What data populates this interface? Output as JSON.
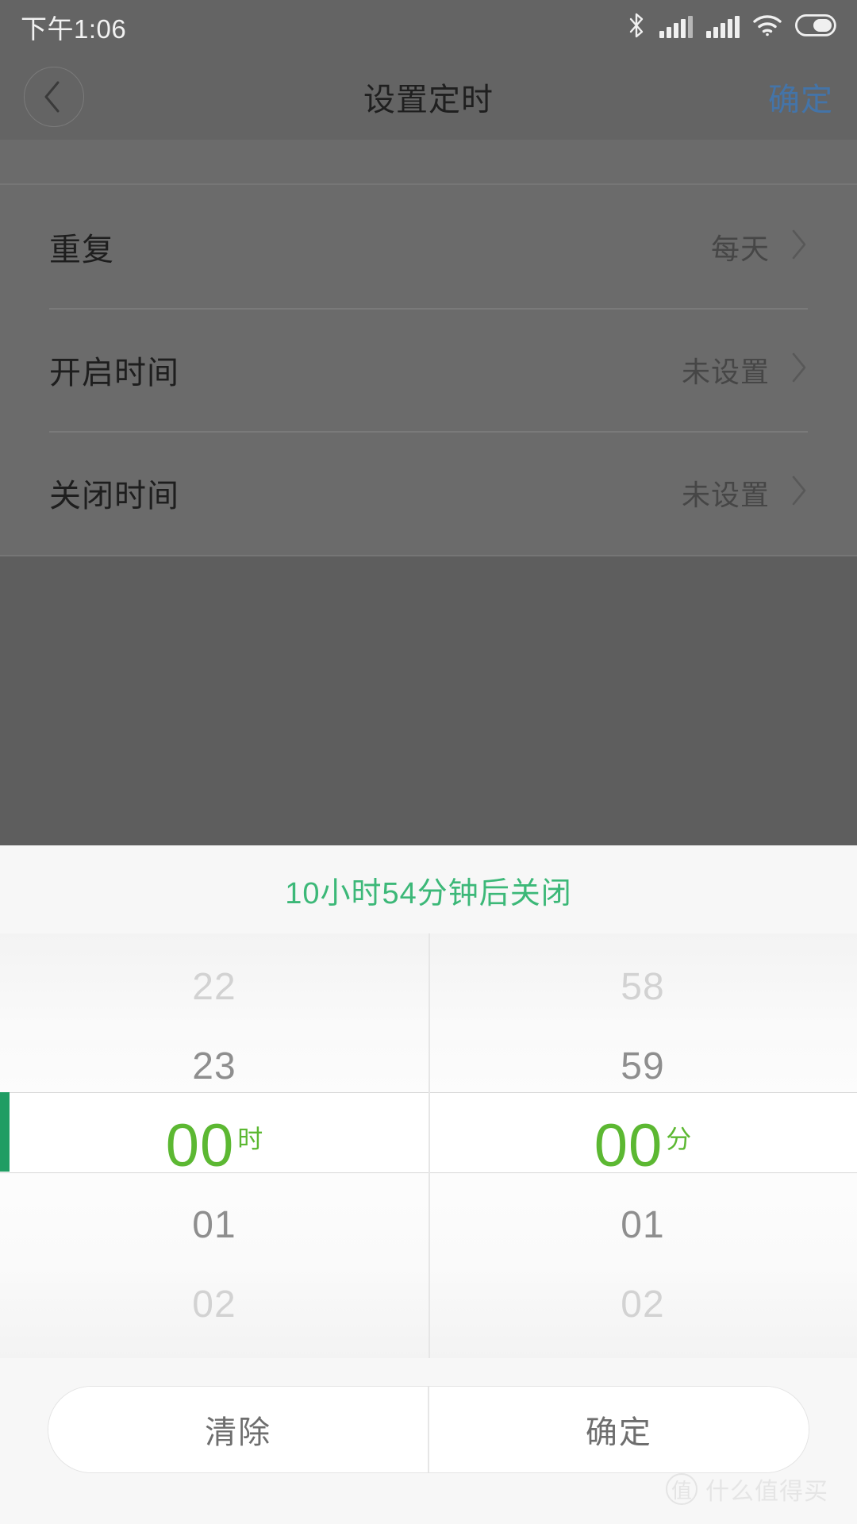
{
  "status_bar": {
    "time": "下午1:06",
    "icons": [
      "bluetooth-icon",
      "signal-icon-1",
      "signal-icon-2",
      "wifi-icon",
      "battery-icon"
    ]
  },
  "title_bar": {
    "back_icon": "chevron-left-icon",
    "title": "设置定时",
    "confirm_label": "确定"
  },
  "settings": {
    "rows": [
      {
        "label": "重复",
        "value": "每天",
        "chevron": "chevron-right-icon"
      },
      {
        "label": "开启时间",
        "value": "未设置",
        "chevron": "chevron-right-icon"
      },
      {
        "label": "关闭时间",
        "value": "未设置",
        "chevron": "chevron-right-icon"
      }
    ]
  },
  "picker": {
    "hint": "10小时54分钟后关闭",
    "hour": {
      "unit": "时",
      "selected": "00",
      "above2": "22",
      "above1": "23",
      "below1": "01",
      "below2": "02"
    },
    "minute": {
      "unit": "分",
      "selected": "00",
      "above2": "58",
      "above1": "59",
      "below1": "01",
      "below2": "02"
    },
    "clear_label": "清除",
    "confirm_label": "确定"
  },
  "watermark": {
    "badge": "值",
    "text": "什么值得买"
  },
  "colors": {
    "accent_green": "#5cb832",
    "hint_green": "#3cb878",
    "marker_green": "#1f9d63",
    "confirm_blue": "#4474a8",
    "backdrop": "#646464"
  }
}
